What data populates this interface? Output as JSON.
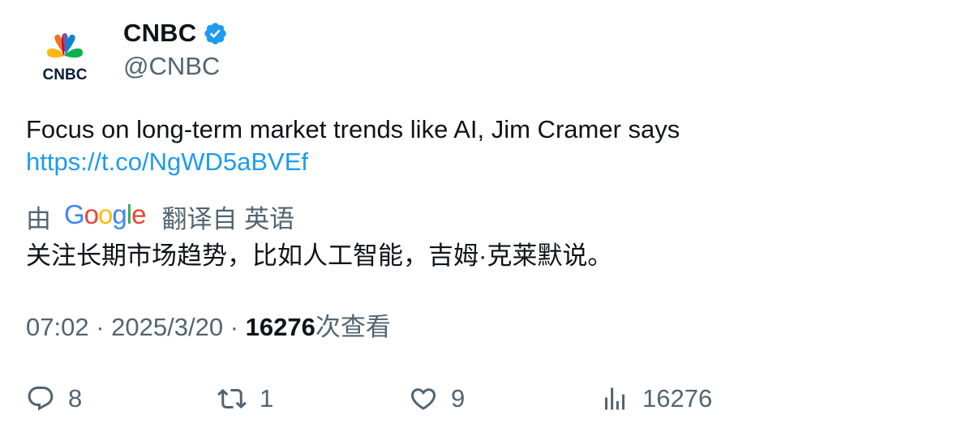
{
  "author": {
    "display_name": "CNBC",
    "handle": "@CNBC",
    "verified": true,
    "avatar_icon": "cnbc-peacock-logo",
    "avatar_text": "CNBC"
  },
  "tweet": {
    "text": "Focus on long-term market trends like AI, Jim Cramer says",
    "link": "https://t.co/NgWD5aBVEf"
  },
  "translation": {
    "prefix": "由",
    "provider": "Google",
    "suffix": "翻译自 英语",
    "text": "关注长期市场趋势，比如人工智能，吉姆·克莱默说。"
  },
  "meta": {
    "time": "07:02",
    "separator": "·",
    "date": "2025/3/20",
    "views_count": "16276",
    "views_label": "次查看"
  },
  "actions": {
    "reply_count": "8",
    "retweet_count": "1",
    "like_count": "9",
    "views_count": "16276"
  },
  "colors": {
    "text_primary": "#0f1419",
    "text_secondary": "#536471",
    "link": "#1d9bf0",
    "verified_badge": "#1d9bf0"
  }
}
